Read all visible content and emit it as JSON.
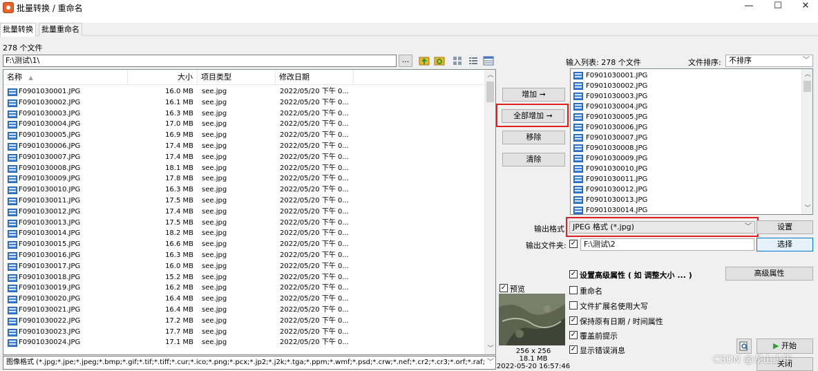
{
  "window": {
    "title": "批量转换 / 重命名",
    "controls": {
      "minimize": "—",
      "maximize": "☐",
      "close": "✕"
    }
  },
  "tabs": [
    {
      "label": "批量转换",
      "active": true
    },
    {
      "label": "批量重命名",
      "active": false
    }
  ],
  "file_panel": {
    "count_label": "278 个文件",
    "path": "F:\\测试\\1\\",
    "browse_label": "...",
    "columns": {
      "name": "名称",
      "size": "大小",
      "type": "项目类型",
      "modified": "修改日期"
    },
    "rows": [
      {
        "name": "F0901030001.JPG",
        "size": "16.0 MB",
        "type": "see.jpg",
        "date": "2022/05/20 下午 0..."
      },
      {
        "name": "F0901030002.JPG",
        "size": "16.1 MB",
        "type": "see.jpg",
        "date": "2022/05/20 下午 0..."
      },
      {
        "name": "F0901030003.JPG",
        "size": "16.3 MB",
        "type": "see.jpg",
        "date": "2022/05/20 下午 0..."
      },
      {
        "name": "F0901030004.JPG",
        "size": "17.0 MB",
        "type": "see.jpg",
        "date": "2022/05/20 下午 0..."
      },
      {
        "name": "F0901030005.JPG",
        "size": "16.9 MB",
        "type": "see.jpg",
        "date": "2022/05/20 下午 0..."
      },
      {
        "name": "F0901030006.JPG",
        "size": "17.4 MB",
        "type": "see.jpg",
        "date": "2022/05/20 下午 0..."
      },
      {
        "name": "F0901030007.JPG",
        "size": "17.4 MB",
        "type": "see.jpg",
        "date": "2022/05/20 下午 0..."
      },
      {
        "name": "F0901030008.JPG",
        "size": "18.1 MB",
        "type": "see.jpg",
        "date": "2022/05/20 下午 0..."
      },
      {
        "name": "F0901030009.JPG",
        "size": "17.8 MB",
        "type": "see.jpg",
        "date": "2022/05/20 下午 0..."
      },
      {
        "name": "F0901030010.JPG",
        "size": "16.3 MB",
        "type": "see.jpg",
        "date": "2022/05/20 下午 0..."
      },
      {
        "name": "F0901030011.JPG",
        "size": "17.5 MB",
        "type": "see.jpg",
        "date": "2022/05/20 下午 0..."
      },
      {
        "name": "F0901030012.JPG",
        "size": "17.4 MB",
        "type": "see.jpg",
        "date": "2022/05/20 下午 0..."
      },
      {
        "name": "F0901030013.JPG",
        "size": "17.5 MB",
        "type": "see.jpg",
        "date": "2022/05/20 下午 0..."
      },
      {
        "name": "F0901030014.JPG",
        "size": "18.2 MB",
        "type": "see.jpg",
        "date": "2022/05/20 下午 0..."
      },
      {
        "name": "F0901030015.JPG",
        "size": "16.6 MB",
        "type": "see.jpg",
        "date": "2022/05/20 下午 0..."
      },
      {
        "name": "F0901030016.JPG",
        "size": "16.3 MB",
        "type": "see.jpg",
        "date": "2022/05/20 下午 0..."
      },
      {
        "name": "F0901030017.JPG",
        "size": "16.0 MB",
        "type": "see.jpg",
        "date": "2022/05/20 下午 0..."
      },
      {
        "name": "F0901030018.JPG",
        "size": "15.2 MB",
        "type": "see.jpg",
        "date": "2022/05/20 下午 0..."
      },
      {
        "name": "F0901030019.JPG",
        "size": "16.2 MB",
        "type": "see.jpg",
        "date": "2022/05/20 下午 0..."
      },
      {
        "name": "F0901030020.JPG",
        "size": "16.4 MB",
        "type": "see.jpg",
        "date": "2022/05/20 下午 0..."
      },
      {
        "name": "F0901030021.JPG",
        "size": "16.4 MB",
        "type": "see.jpg",
        "date": "2022/05/20 下午 0..."
      },
      {
        "name": "F0901030022.JPG",
        "size": "17.2 MB",
        "type": "see.jpg",
        "date": "2022/05/20 下午 0..."
      },
      {
        "name": "F0901030023.JPG",
        "size": "17.7 MB",
        "type": "see.jpg",
        "date": "2022/05/20 下午 0..."
      },
      {
        "name": "F0901030024.JPG",
        "size": "17.1 MB",
        "type": "see.jpg",
        "date": "2022/05/20 下午 0..."
      }
    ],
    "filter": "图像格式 (*.jpg;*.jpe;*.jpeg;*.bmp;*.gif;*.tif;*.tiff;*.cur;*.ico;*.png;*.pcx;*.jp2;*.j2k;*.tga;*.ppm;*.wmf;*.psd;*.crw;*.nef;*.cr2;*.cr3;*.orf;*.raf;"
  },
  "actions": {
    "add": "增加 ➞",
    "add_all": "全部增加 ➞",
    "remove": "移除",
    "clear": "清除"
  },
  "input_panel": {
    "label": "输入列表: 278 个文件",
    "sort_label": "文件排序:",
    "sort_value": "不排序",
    "items": [
      "F0901030001.JPG",
      "F0901030002.JPG",
      "F0901030003.JPG",
      "F0901030004.JPG",
      "F0901030005.JPG",
      "F0901030006.JPG",
      "F0901030007.JPG",
      "F0901030008.JPG",
      "F0901030009.JPG",
      "F0901030010.JPG",
      "F0901030011.JPG",
      "F0901030012.JPG",
      "F0901030013.JPG",
      "F0901030014.JPG"
    ]
  },
  "output": {
    "format_label": "输出格式",
    "format_value": "JPEG 格式 (*.jpg)",
    "settings_button": "设置",
    "folder_label": "输出文件夹:",
    "folder_value": "F:\\测试\\2",
    "choose_button": "选择"
  },
  "options": {
    "advanced": {
      "label": "设置高级属性 ( 如 调整大小 ... )",
      "checked": true
    },
    "advanced_button": "高级属性",
    "rename": {
      "label": "重命名",
      "checked": false
    },
    "ext_upper": {
      "label": "文件扩展名使用大写",
      "checked": false
    },
    "keep_date": {
      "label": "保持原有日期 / 时间属性",
      "checked": true
    },
    "overwrite_prompt": {
      "label": "覆盖前提示",
      "checked": true
    },
    "show_errors": {
      "label": "显示错误消息",
      "checked": true
    }
  },
  "preview": {
    "label": "预览",
    "checked": true,
    "dimensions": "256 x 256",
    "size": "18.1 MB",
    "datetime": "2022-05-20 16:57:46"
  },
  "footer": {
    "start_button": "开始",
    "close_button": "关闭"
  },
  "watermark": "CSDN @龙山少年",
  "colors": {
    "highlight_box": "#e02020",
    "accent": "#0078d7"
  }
}
